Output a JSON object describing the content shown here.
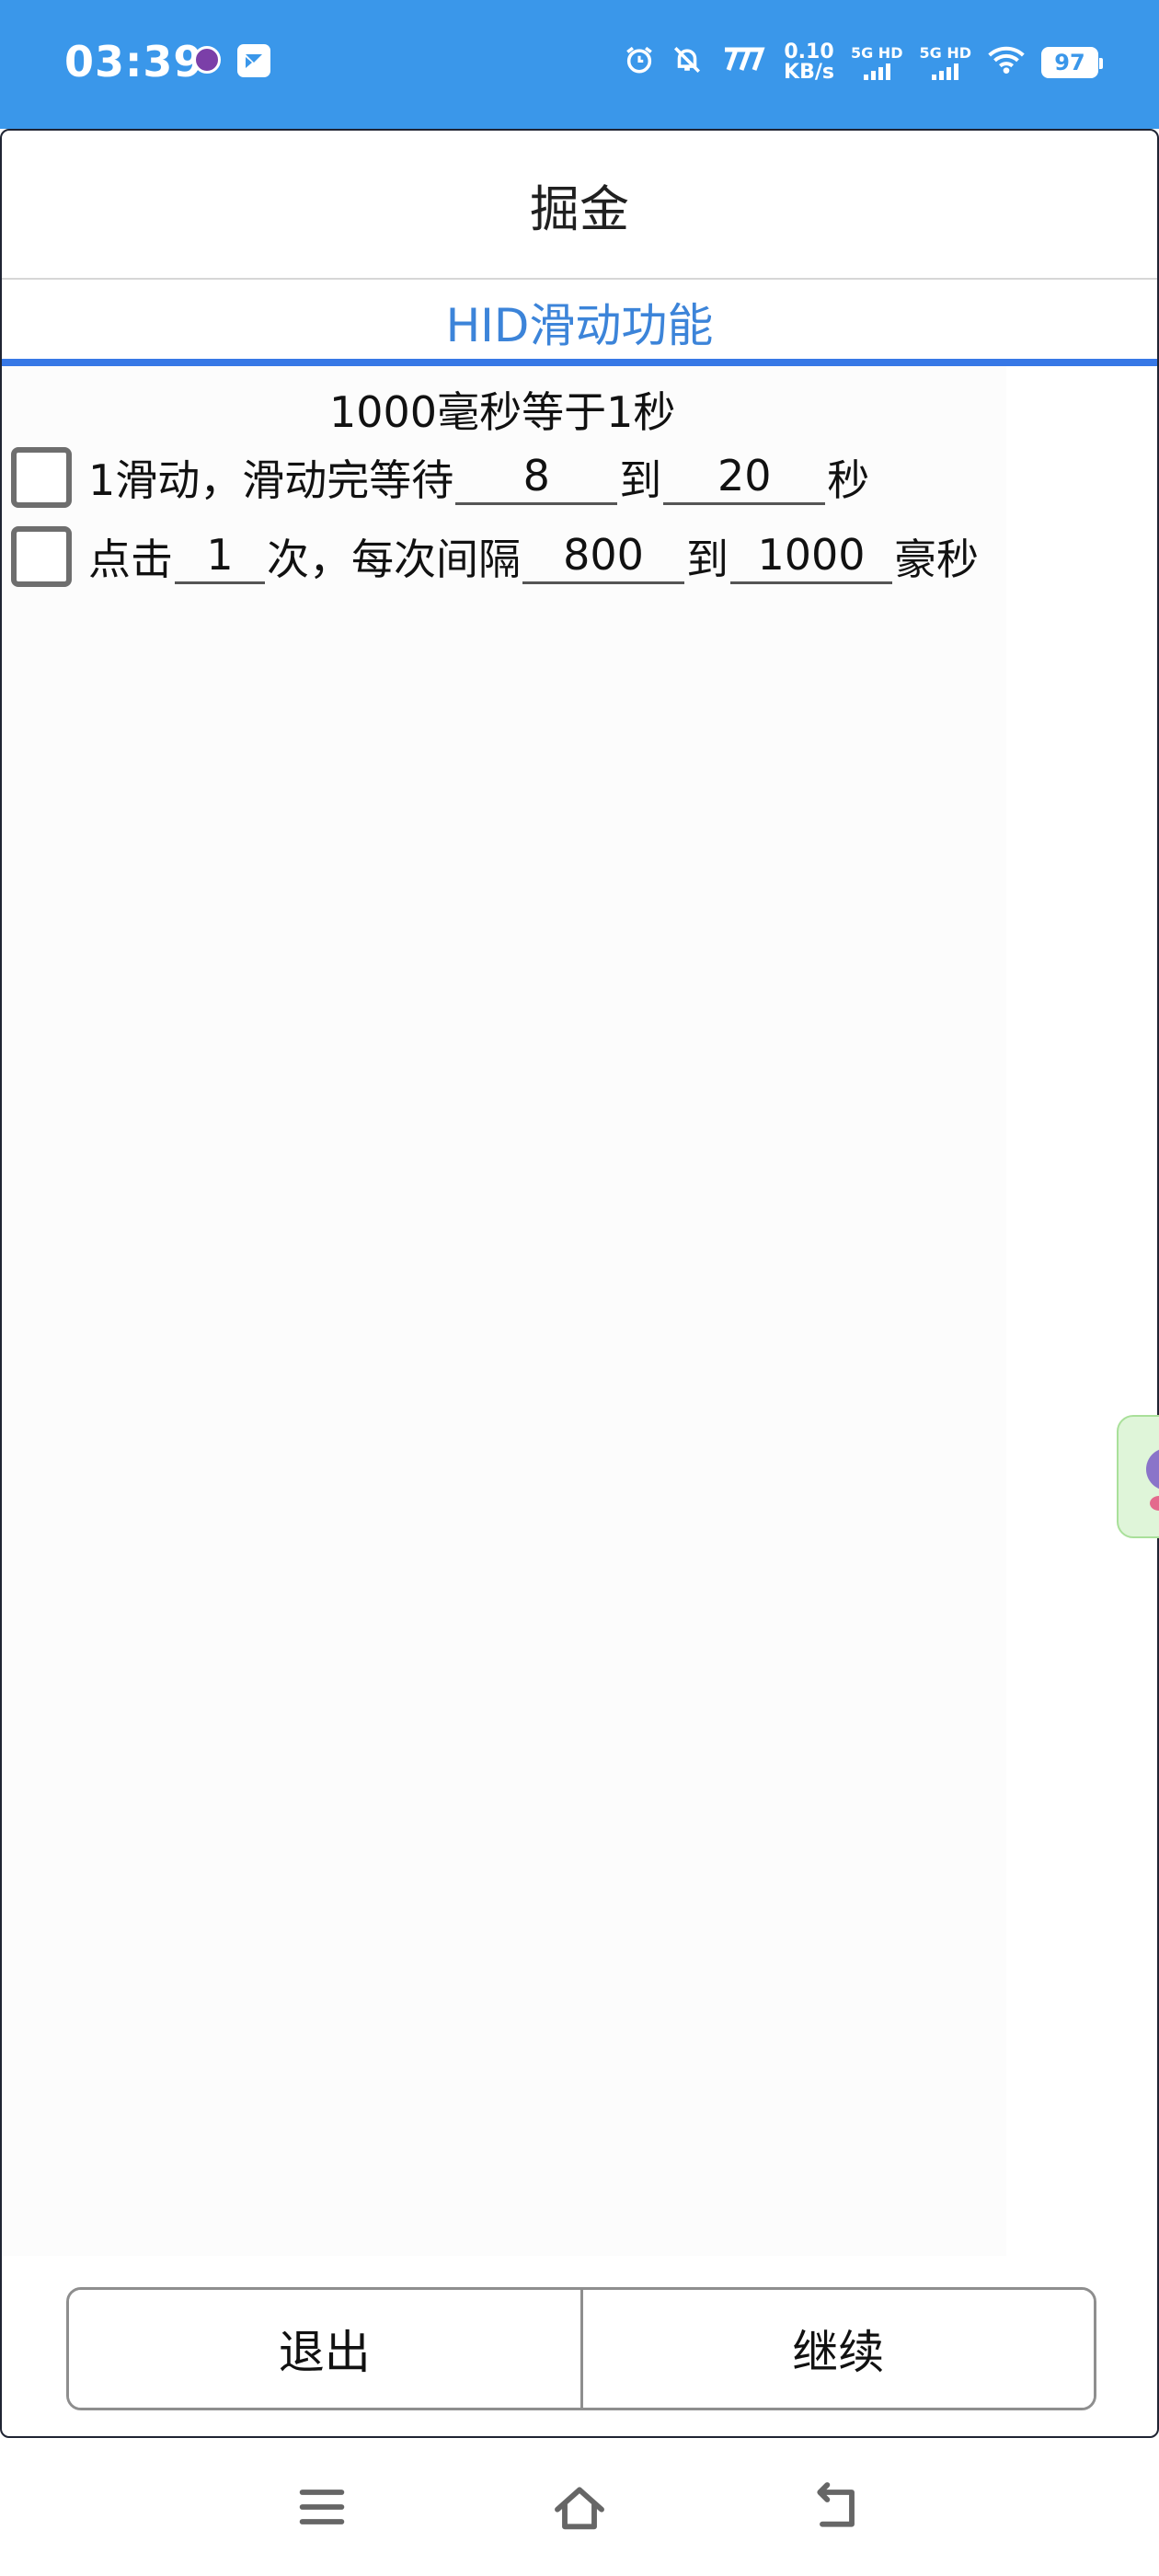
{
  "status_bar": {
    "time": "03:39",
    "net_speed_value": "0.10",
    "net_speed_unit": "KB/s",
    "sim1_label": "5G HD",
    "sim2_label": "5G HD",
    "battery": "97",
    "icons": [
      "app-notification-icon",
      "message-app-icon",
      "alarm-icon",
      "mute-bell-icon",
      "carrier-icon",
      "signal-icon",
      "wifi-icon",
      "battery-icon"
    ],
    "color": "#3a97ea"
  },
  "dialog": {
    "title": "掘金",
    "tab": "HID滑动功能",
    "tab_color": "#3c84d9",
    "note": "1000毫秒等于1秒",
    "row1": {
      "label_a": "1滑动，滑动完等待",
      "wait_min": "8",
      "label_b": "到",
      "wait_max": "20",
      "label_c": "秒",
      "checked": false
    },
    "row2": {
      "label_a": "点击",
      "count": "1",
      "label_b": "次，每次间隔",
      "interval_min": "800",
      "label_c": "到",
      "interval_max": "1000",
      "label_d": "豪秒",
      "checked": false
    },
    "buttons": {
      "exit": "退出",
      "continue": "继续"
    }
  },
  "nav_bar": {
    "icons": [
      "menu-icon",
      "home-icon",
      "back-icon"
    ]
  }
}
